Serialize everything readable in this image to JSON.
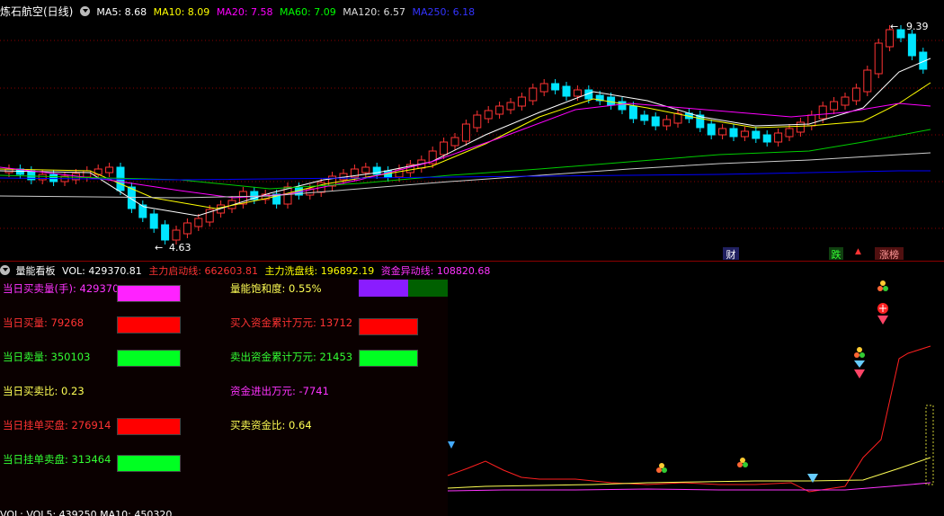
{
  "header": {
    "title": "炼石航空(日线)",
    "ma5": "MA5: 8.68",
    "ma10": "MA10: 8.09",
    "ma20": "MA20: 7.58",
    "ma60": "MA60: 7.09",
    "ma120": "MA120: 6.57",
    "ma250": "MA250: 6.18"
  },
  "price_labels": {
    "high": "9.39",
    "low": "4.63"
  },
  "event_tags": {
    "cai": "财",
    "die": "跌",
    "zhangbang": "涨榜"
  },
  "indicator_header": {
    "name": "量能看板",
    "vol": "VOL: 429370.81",
    "start_line": "主力启动线: 662603.81",
    "wash_line": "主力洗盘线: 196892.19",
    "abnormal_line": "资金异动线: 108820.68"
  },
  "panel_left": [
    {
      "label": "当日买卖量(手): 429370",
      "color": "#ff33ff",
      "bar": "#ff22ff"
    },
    {
      "label": "当日买量: 79268",
      "color": "#ff3333",
      "bar": "#ff0000"
    },
    {
      "label": "当日卖量: 350103",
      "color": "#33ff33",
      "bar": "#00ff22"
    },
    {
      "label": "当日买卖比: 0.23",
      "color": "#ffff55",
      "bar": null
    },
    {
      "label": "当日挂单买盘: 276914",
      "color": "#ff3333",
      "bar": "#ff0000"
    },
    {
      "label": "当日挂单卖盘: 313464",
      "color": "#33ff33",
      "bar": "#00ff22"
    }
  ],
  "panel_right": [
    {
      "label": "量能饱和度: 0.55%",
      "color": "#ffff55"
    },
    {
      "label": "买入资金累计万元: 13712",
      "color": "#ff3333"
    },
    {
      "label": "卖出资金累计万元: 21453",
      "color": "#33ff33"
    },
    {
      "label": "资金进出万元: -7741",
      "color": "#ff33ff"
    },
    {
      "label": "买卖资金比: 0.64",
      "color": "#ffff55"
    }
  ],
  "bottom_text": "VOL: VOL5: 439250 MA10: 450320",
  "colors": {
    "up": "#ff3333",
    "down": "#00e5ff",
    "ma5": "#ffffff",
    "ma10": "#ffff00",
    "ma20": "#ff00ff",
    "ma60": "#00cc00",
    "ma120": "#cccccc",
    "ma250": "#0000ff"
  }
}
